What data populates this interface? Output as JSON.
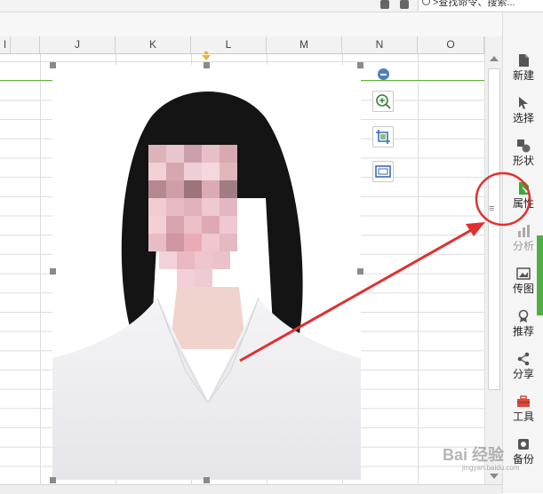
{
  "toolbar": {
    "search_text": ">查找命令、搜索..."
  },
  "columns": [
    "I",
    "J",
    "K",
    "L",
    "M",
    "N",
    "O"
  ],
  "sidebar": {
    "items": [
      {
        "label": "新建",
        "icon": "new-file-icon"
      },
      {
        "label": "选择",
        "icon": "select-cursor-icon"
      },
      {
        "label": "形状",
        "icon": "shape-icon"
      },
      {
        "label": "属性",
        "icon": "property-icon"
      },
      {
        "label": "分析",
        "icon": "analysis-icon"
      },
      {
        "label": "传图",
        "icon": "upload-image-icon"
      },
      {
        "label": "推荐",
        "icon": "recommend-icon"
      },
      {
        "label": "分享",
        "icon": "share-icon"
      },
      {
        "label": "工具",
        "icon": "toolbox-icon"
      },
      {
        "label": "备份",
        "icon": "backup-icon"
      }
    ]
  },
  "scroll": {
    "grip": "≡"
  },
  "watermark": {
    "text": "Bai 经验",
    "sub": "jingyan.baidu.com"
  },
  "colors": {
    "accent_green": "#4caf3f",
    "annotation_red": "#e03030",
    "frozen_line": "#5fb336"
  }
}
